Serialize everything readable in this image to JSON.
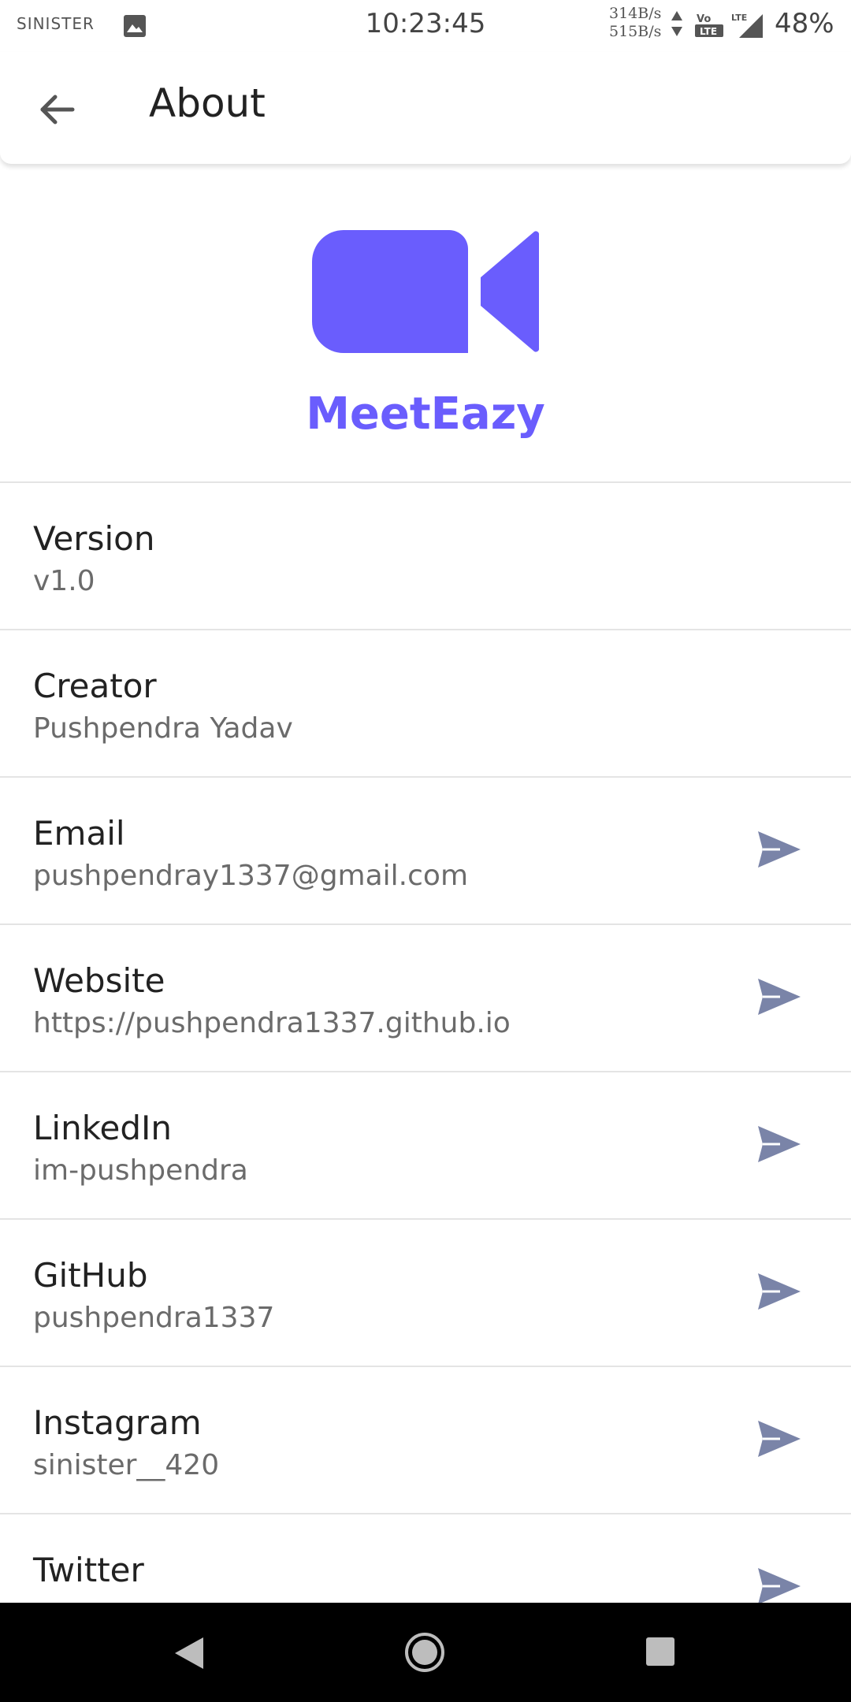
{
  "status_bar": {
    "carrier": "SINISTER",
    "time": "10:23:45",
    "up_speed": "314B/s",
    "down_speed": "515B/s",
    "network_label": "LTE",
    "battery": "48%"
  },
  "app_bar": {
    "title": "About",
    "back_icon": "arrow-back-icon"
  },
  "hero": {
    "app_name": "MeetEazy",
    "logo_icon": "video-camera-icon",
    "brand_color": "#6a5dfd"
  },
  "items": [
    {
      "title": "Version",
      "value": "v1.0"
    },
    {
      "title": "Creator",
      "value": "Pushpendra Yadav"
    },
    {
      "title": "Email",
      "value": "pushpendray1337@gmail.com"
    },
    {
      "title": "Website",
      "value": "https://pushpendra1337.github.io"
    },
    {
      "title": "LinkedIn",
      "value": "im-pushpendra"
    },
    {
      "title": "GitHub",
      "value": "pushpendra1337"
    },
    {
      "title": "Instagram",
      "value": "sinister__420"
    },
    {
      "title": "Twitter",
      "value": ""
    }
  ],
  "colors": {
    "send_icon": "#7a84a8",
    "accent": "#6a5dfd"
  },
  "nav": {
    "back_icon": "nav-back-icon",
    "home_icon": "nav-home-icon",
    "recents_icon": "nav-recents-icon"
  }
}
